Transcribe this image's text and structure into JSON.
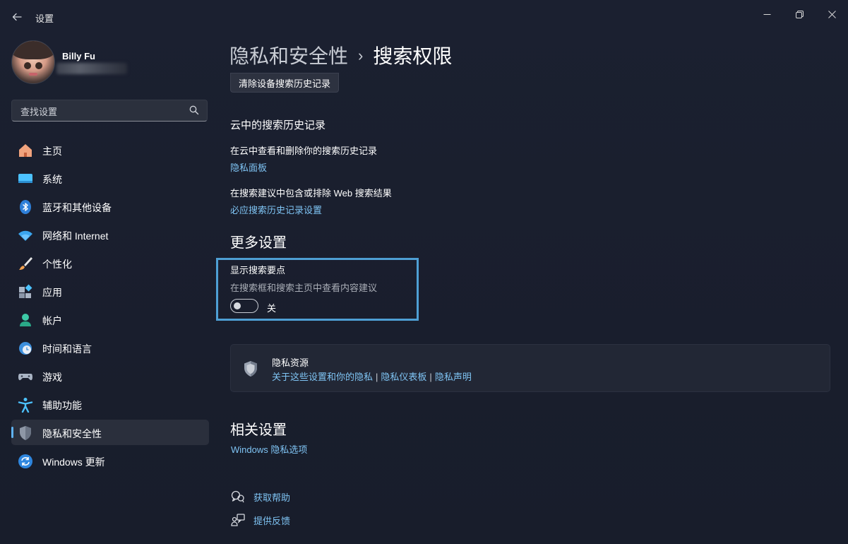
{
  "window": {
    "title": "设置",
    "controls": {
      "minimize": "—",
      "maximize": "❐",
      "close": "✕"
    }
  },
  "profile": {
    "name": "Billy Fu"
  },
  "search": {
    "placeholder": "查找设置"
  },
  "sidebar": {
    "items": [
      {
        "label": "主页",
        "icon": "home-icon"
      },
      {
        "label": "系统",
        "icon": "system-icon"
      },
      {
        "label": "蓝牙和其他设备",
        "icon": "bluetooth-icon"
      },
      {
        "label": "网络和 Internet",
        "icon": "wifi-icon"
      },
      {
        "label": "个性化",
        "icon": "brush-icon"
      },
      {
        "label": "应用",
        "icon": "apps-icon"
      },
      {
        "label": "帐户",
        "icon": "account-icon"
      },
      {
        "label": "时间和语言",
        "icon": "time-language-icon"
      },
      {
        "label": "游戏",
        "icon": "gamepad-icon"
      },
      {
        "label": "辅助功能",
        "icon": "accessibility-icon"
      },
      {
        "label": "隐私和安全性",
        "icon": "shield-icon",
        "active": true
      },
      {
        "label": "Windows 更新",
        "icon": "update-icon"
      }
    ]
  },
  "main": {
    "breadcrumb": {
      "parent": "隐私和安全性",
      "separator": "›",
      "current": "搜索权限"
    },
    "clear_history_button": "清除设备搜索历史记录",
    "cloud_history": {
      "heading": "云中的搜索历史记录",
      "row1_text": "在云中查看和删除你的搜索历史记录",
      "row1_link": "隐私面板",
      "row2_text": "在搜索建议中包含或排除 Web 搜索结果",
      "row2_link": "必应搜索历史记录设置"
    },
    "more_settings": {
      "heading": "更多设置",
      "show_highlights_title": "显示搜索要点",
      "show_highlights_desc": "在搜索框和搜索主页中查看内容建议",
      "toggle_state": "关",
      "toggle_on": false
    },
    "privacy_resources": {
      "title": "隐私资源",
      "links": [
        "关于这些设置和你的隐私",
        "隐私仪表板",
        "隐私声明"
      ],
      "separator": "|"
    },
    "related": {
      "heading": "相关设置",
      "link": "Windows 隐私选项"
    },
    "help": {
      "get_help": "获取帮助",
      "feedback": "提供反馈"
    }
  },
  "colors": {
    "accent": "#5fb2f2",
    "link": "#7fc4f4",
    "highlight_border": "#4e9fd4",
    "background": "#1a1f2e"
  }
}
